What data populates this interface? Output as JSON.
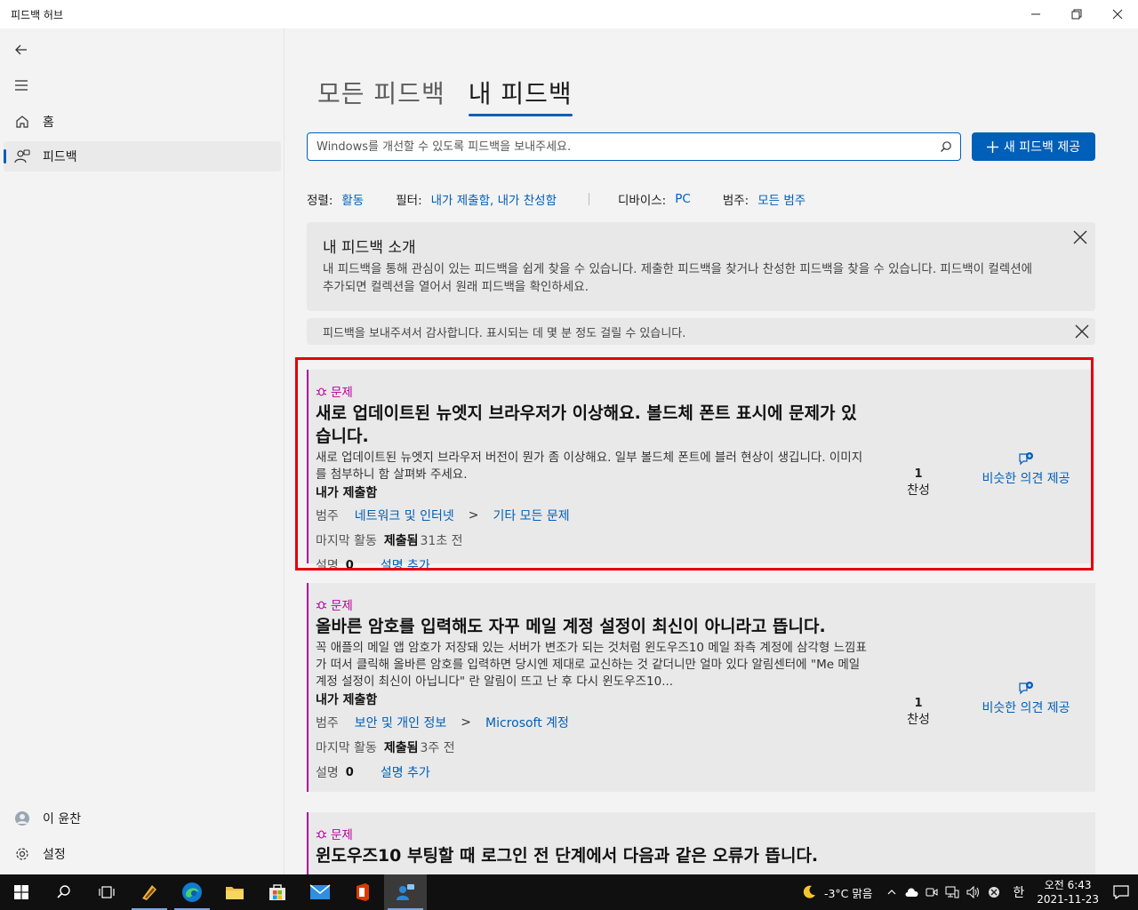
{
  "window": {
    "title": "피드백 허브"
  },
  "sidebar": {
    "home": "홈",
    "feedback": "피드백",
    "user": "이 윤찬",
    "settings": "설정"
  },
  "pivots": {
    "all": "모든 피드백",
    "mine": "내 피드백"
  },
  "search": {
    "placeholder": "Windows를 개선할 수 있도록 피드백을 보내주세요."
  },
  "new_feedback_button": "새 피드백 제공",
  "filters": {
    "sort_label": "정렬:",
    "sort_value": "활동",
    "filter_label": "필터:",
    "filter_value": "내가 제출함, 내가 찬성함",
    "device_label": "디바이스:",
    "device_value": "PC",
    "category_label": "범주:",
    "category_value": "모든 범주"
  },
  "intro": {
    "title": "내 피드백 소개",
    "body": "내 피드백을 통해 관심이 있는 피드백을 쉽게 찾을 수 있습니다. 제출한 피드백을 찾거나 찬성한 피드백을 찾을 수 있습니다. 피드백이 컬렉션에 추가되면 컬렉션을 열어서 원래 피드백을 확인하세요."
  },
  "notice": "피드백을 보내주셔서 감사합니다. 표시되는 데 몇 분 정도 걸릴 수 있습니다.",
  "labels": {
    "category": "범주",
    "last_activity": "마지막 활동",
    "submitted": "제출됨",
    "comments": "설명",
    "add_comment": "설명 추가",
    "submitted_by_me": "내가 제출함",
    "upvote": "찬성",
    "similar": "비슷한 의견 제공",
    "separator": ">"
  },
  "cards": [
    {
      "tag": "문제",
      "title": "새로 업데이트된 뉴엣지 브라우저가 이상해요. 볼드체 폰트 표시에 문제가 있습니다.",
      "desc": "새로 업데이트된 뉴엣지 브라우저 버전이 뭔가 좀 이상해요. 일부 볼드체 폰트에 블러 현상이 생깁니다. 이미지를 첨부하니 함 살펴봐 주세요.",
      "cat1": "네트워크 및 인터넷",
      "cat2": "기타 모든 문제",
      "time": "31초 전",
      "comments": "0",
      "votes": "1"
    },
    {
      "tag": "문제",
      "title": "올바른 암호를 입력해도 자꾸 메일 계정 설정이 최신이 아니라고 뜹니다.",
      "desc": "꼭 애플의 메일 앱 암호가 저장돼 있는 서버가 변조가 되는 것처럼 윈도우즈10 메일 좌측 계정에 삼각형 느낌표가 떠서 클릭해 올바른 암호를 입력하면 당시엔 제대로 교신하는 것 같더니만 얼마 있다 알림센터에 \"Me 메일 계정 설정이 최신이 아닙니다\" 란 알림이 뜨고 난 후 다시 윈도우즈10...",
      "cat1": "보안 및 개인 정보",
      "cat2": "Microsoft 계정",
      "time": "3주 전",
      "comments": "0",
      "votes": "1"
    },
    {
      "tag": "문제",
      "title": "윈도우즈10 부팅할 때 로그인 전 단계에서 다음과 같은 오류가 뜹니다."
    }
  ],
  "taskbar": {
    "weather": "-3°C 맑음",
    "ime": "한",
    "time": "오전 6:43",
    "date": "2021-11-23"
  },
  "colors": {
    "accent": "#005fb8",
    "issue": "#b4009e",
    "highlight": "#e3000b"
  }
}
